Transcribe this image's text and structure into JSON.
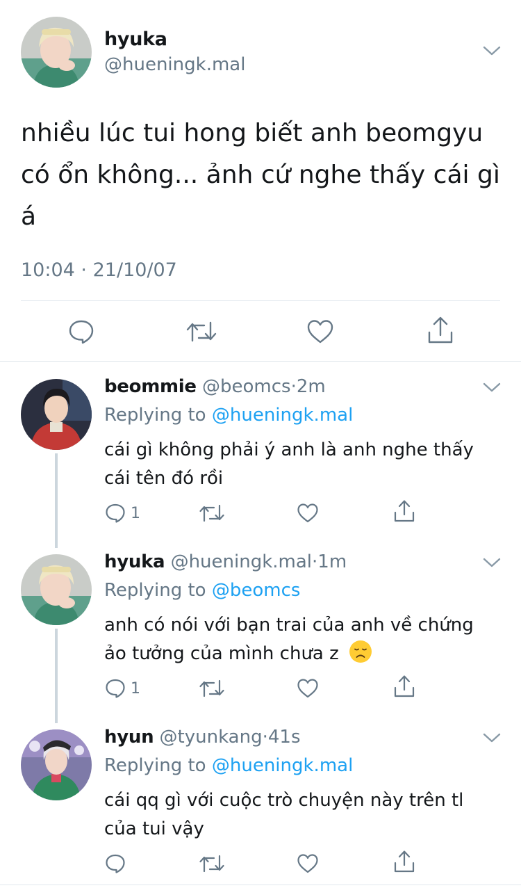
{
  "main_tweet": {
    "name": "hyuka",
    "handle": "@hueningk.mal",
    "text": "nhiều lúc tui hong biết anh beomgyu có ổn không... ảnh cứ nghe thấy cái gì á",
    "time": "10:04",
    "sep": "·",
    "date": "21/10/07"
  },
  "replies": [
    {
      "name": "beommie",
      "handle": "@beomcs",
      "sep": "·",
      "time": "2m",
      "replying_prefix": "Replying to",
      "replying_to": "@hueningk.mal",
      "text_line1": "cái gì không phải ý anh là anh nghe thấy",
      "text_line2": "cái tên đó rồi",
      "reply_count": "1"
    },
    {
      "name": "hyuka",
      "handle": "@hueningk.mal",
      "sep": "·",
      "time": "1m",
      "replying_prefix": "Replying to",
      "replying_to": "@beomcs",
      "text_line1": "anh có nói với bạn trai của anh về chứng",
      "text_line2": "ảo tưởng của mình chưa z",
      "reply_count": "1"
    },
    {
      "name": "hyun",
      "handle": "@tyunkang",
      "sep": "·",
      "time": "41s",
      "replying_prefix": "Replying to",
      "replying_to": "@hueningk.mal",
      "text_line1": "cái qq gì với cuộc trò chuyện này trên tl",
      "text_line2": "của tui vậy",
      "reply_count": ""
    }
  ],
  "icons": {
    "reply": "reply-icon",
    "retweet": "retweet-icon",
    "like": "like-icon",
    "share": "share-icon",
    "menu": "chevron-down-icon",
    "emoji": "disappointed-face-emoji"
  },
  "colors": {
    "link": "#1da1f2",
    "muted": "#657786",
    "icon": "#657786",
    "divider": "#e1e8ed"
  }
}
